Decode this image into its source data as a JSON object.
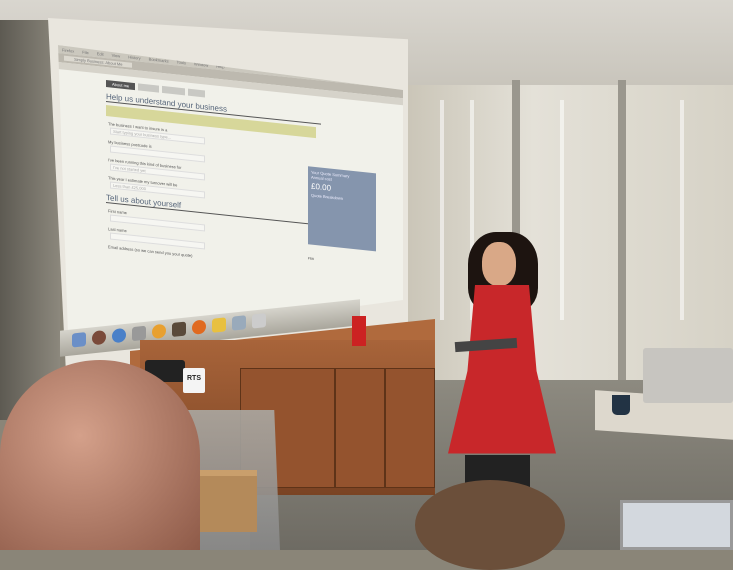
{
  "scene": {
    "description_colors": {
      "dress": "#c8272a",
      "cabinet": "#a8643a",
      "summary_panel": "#8595ad"
    }
  },
  "projected": {
    "menu": [
      "Firefox",
      "File",
      "Edit",
      "View",
      "History",
      "Bookmarks",
      "Tools",
      "Window",
      "Help"
    ],
    "tab_title": "Simply Business: About Me",
    "nav_tabs": [
      "About me",
      "",
      "",
      ""
    ],
    "section1_title": "Help us understand your business",
    "fields": [
      {
        "label": "The business I want to insure is a",
        "value": "Start typing your business type..."
      },
      {
        "label": "My business postcode is",
        "value": ""
      },
      {
        "label": "I've been running this kind of business for",
        "value": "I've not started yet"
      },
      {
        "label": "This year I estimate my turnover will be",
        "value": "Less than £25,000"
      }
    ],
    "section2_title": "Tell us about yourself",
    "fields2": [
      {
        "label": "First name"
      },
      {
        "label": "Last name"
      },
      {
        "label": "Email address (so we can send you your quote)"
      }
    ],
    "summary": {
      "title": "Your Quote Summary",
      "subtitle": "Annual cost",
      "price": "£0.00",
      "breakdown_title": "Quote Breakdown"
    },
    "fsa": "FSA"
  },
  "mug_text": "RTS"
}
